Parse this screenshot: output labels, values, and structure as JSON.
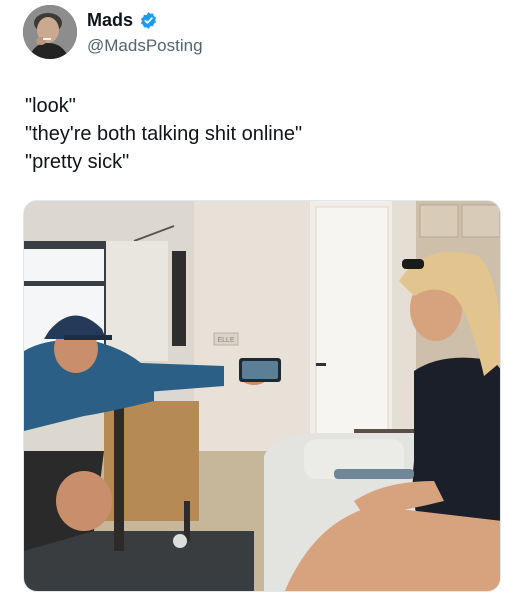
{
  "author": {
    "display_name": "Mads",
    "handle": "@MadsPosting",
    "verified": true,
    "verified_color": "#1d9bf0",
    "avatar_icon": "profile-photo"
  },
  "tweet": {
    "lines": [
      "\"look\"",
      "\"they're both talking shit online\"",
      "\"pretty sick\""
    ]
  },
  "media": {
    "type": "photo",
    "panel_label": "ELLE"
  }
}
